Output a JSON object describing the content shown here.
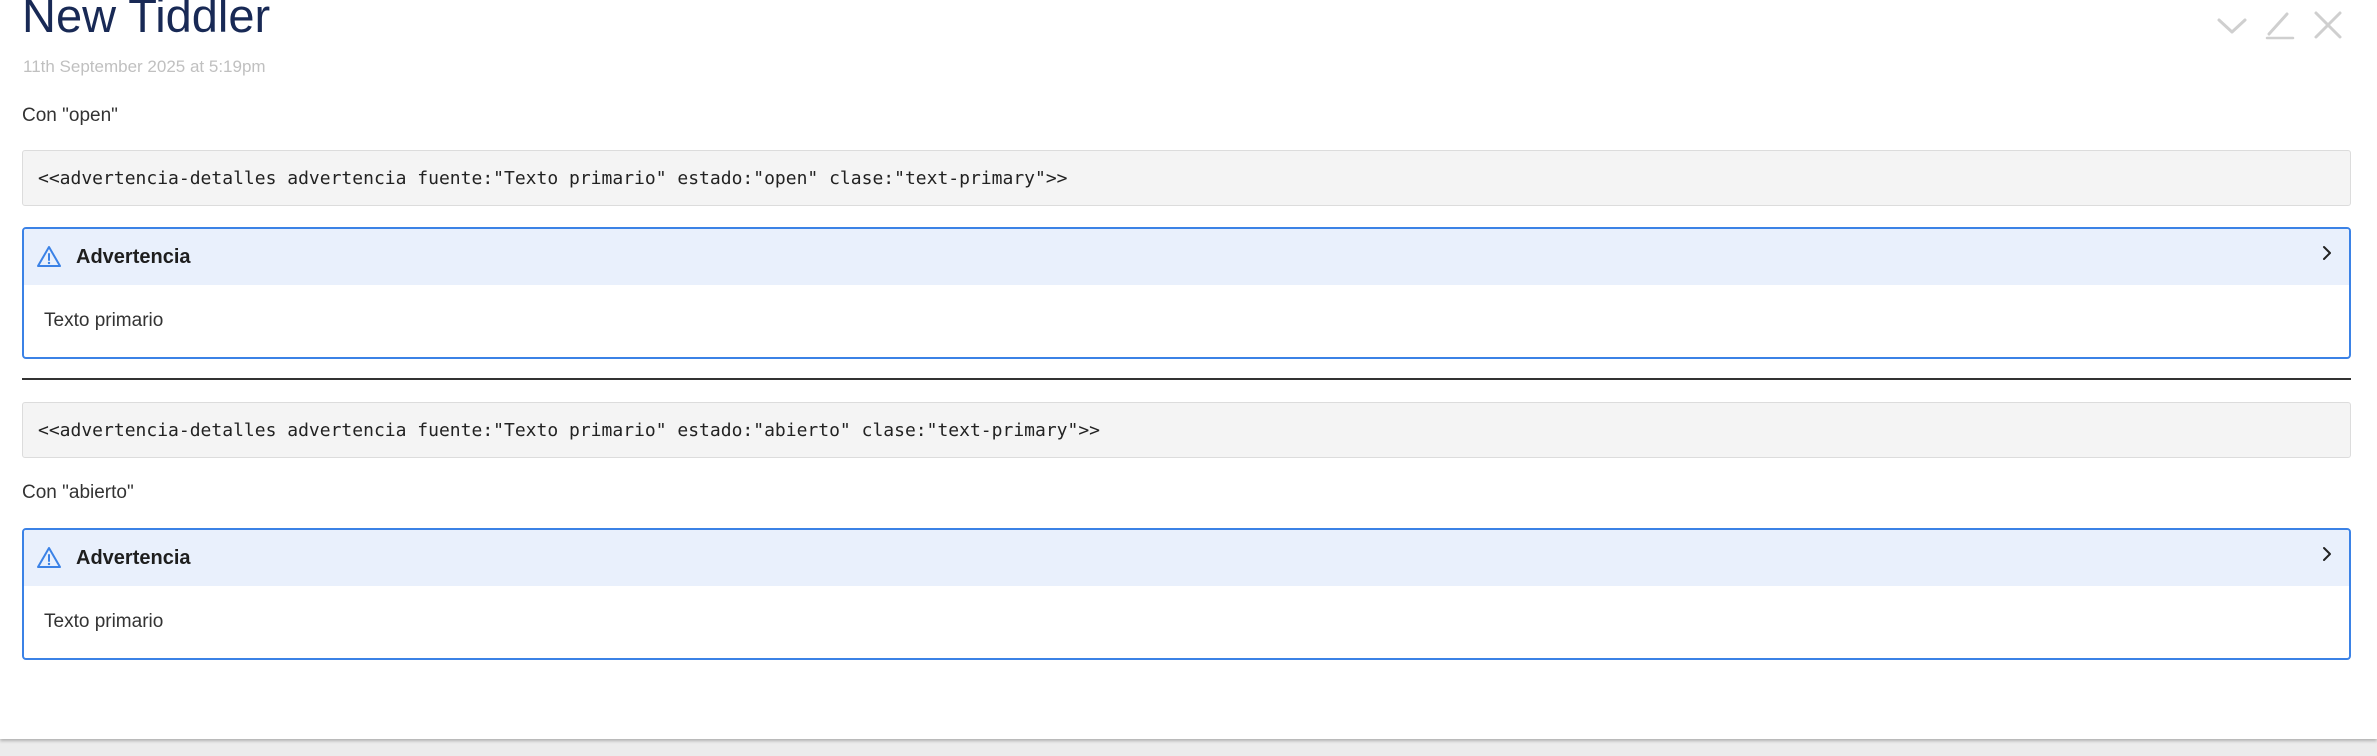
{
  "tiddler": {
    "title": "New Tiddler",
    "subtitle": "11th September 2025 at 5:19pm",
    "controls": {
      "done_icon": "checkmark-icon",
      "edit_icon": "pencil-icon",
      "close_icon": "close-icon"
    }
  },
  "body": {
    "para_open": "Con \"open\"",
    "code_open": "<<advertencia-detalles advertencia fuente:\"Texto primario\" estado:\"open\" clase:\"text-primary\">>",
    "details_open": {
      "summary": "Advertencia",
      "content": "Texto primario"
    },
    "code_abierto": "<<advertencia-detalles advertencia fuente:\"Texto primario\" estado:\"abierto\" clase:\"text-primary\">>",
    "para_abierto": "Con \"abierto\"",
    "details_abierto": {
      "summary": "Advertencia",
      "content": "Texto primario"
    }
  },
  "colors": {
    "title": "#182955",
    "accent": "#3b82e6",
    "summary_bg": "#e9f0fc",
    "code_bg": "#f4f4f4"
  }
}
